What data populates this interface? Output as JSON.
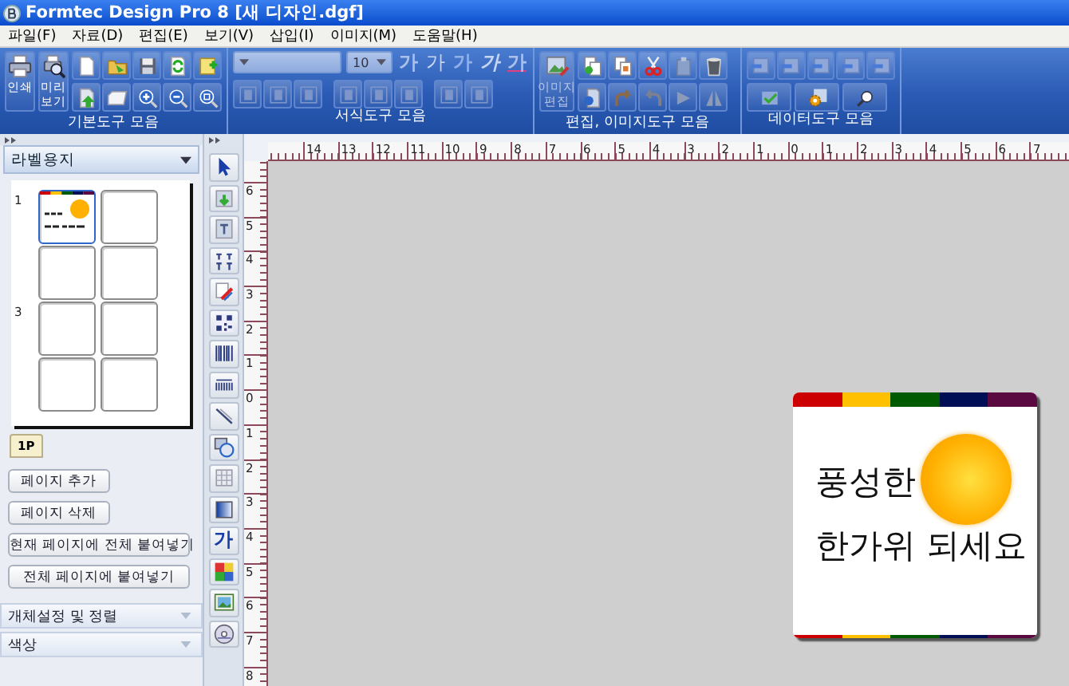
{
  "window": {
    "title": "Formtec Design Pro 8 [새 디자인.dgf]"
  },
  "menu": [
    "파일(F)",
    "자료(D)",
    "편집(E)",
    "보기(V)",
    "삽입(I)",
    "이미지(M)",
    "도움말(H)"
  ],
  "toolbar": [
    {
      "kind": "basic",
      "label": "기본도구 모음",
      "buttons": [
        "인쇄",
        "미리 보기"
      ]
    },
    {
      "kind": "format",
      "label": "서식도구 모음",
      "font_size": "10",
      "style_buttons": [
        "가",
        "가",
        "가",
        "가",
        "가"
      ]
    },
    {
      "kind": "edit",
      "label": "편집, 이미지도구 모음",
      "buttons": [
        "이미지 편집"
      ]
    },
    {
      "kind": "data",
      "label": "데이터도구 모음"
    }
  ],
  "left_panel": {
    "header": "라벨용지",
    "rows": [
      {
        "label": "1",
        "cells": [
          {
            "kind": "design",
            "selected": true
          },
          {
            "kind": "empty",
            "selected": false
          }
        ]
      },
      {
        "cells": [
          {
            "kind": "empty",
            "selected": false
          },
          {
            "kind": "empty",
            "selected": false
          }
        ]
      },
      {
        "label": "3",
        "cells": [
          {
            "kind": "empty",
            "selected": false
          },
          {
            "kind": "empty",
            "selected": false
          }
        ]
      },
      {
        "cells": [
          {
            "kind": "empty",
            "selected": false
          },
          {
            "kind": "empty",
            "selected": false
          }
        ]
      }
    ],
    "page_tabs": [
      {
        "label": "1P",
        "selected": true
      }
    ],
    "buttons": [
      "페이지 추가",
      "페이지 삭제",
      "현재 페이지에 전체 붙여넣기",
      "전체 페이지에 붙여넣기"
    ],
    "sections": [
      "개체설정 및 정렬",
      "색상"
    ]
  },
  "tools": [
    {
      "kind": "pointer"
    },
    {
      "kind": "image"
    },
    {
      "kind": "textbox"
    },
    {
      "kind": "styles"
    },
    {
      "kind": "pen"
    },
    {
      "kind": "qrcode"
    },
    {
      "kind": "barcode"
    },
    {
      "kind": "barcode2"
    },
    {
      "kind": "line"
    },
    {
      "kind": "shapes"
    },
    {
      "kind": "table"
    },
    {
      "kind": "gradient"
    },
    {
      "kind": "text",
      "label": "가"
    },
    {
      "kind": "palette"
    },
    {
      "kind": "photo"
    },
    {
      "kind": "disc"
    }
  ],
  "ruler": {
    "horizontal": [
      "14",
      "13",
      "12",
      "11",
      "10",
      "9",
      "8",
      "7",
      "6",
      "5",
      "4",
      "3",
      "2",
      "1",
      "0",
      "1",
      "2",
      "3",
      "4",
      "5",
      "6",
      "7"
    ],
    "vertical": [
      "6",
      "5",
      "4",
      "3",
      "2",
      "1",
      "0",
      "1",
      "2",
      "3",
      "4",
      "5",
      "6",
      "7",
      "8"
    ]
  },
  "label": {
    "stripes": [
      {
        "color": "#cc0000"
      },
      {
        "color": "#ffc000"
      },
      {
        "color": "#005a00"
      },
      {
        "color": "#000f55"
      },
      {
        "color": "#5a0a40"
      }
    ],
    "lines": [
      "풍성한",
      "한가위 되세요"
    ]
  }
}
